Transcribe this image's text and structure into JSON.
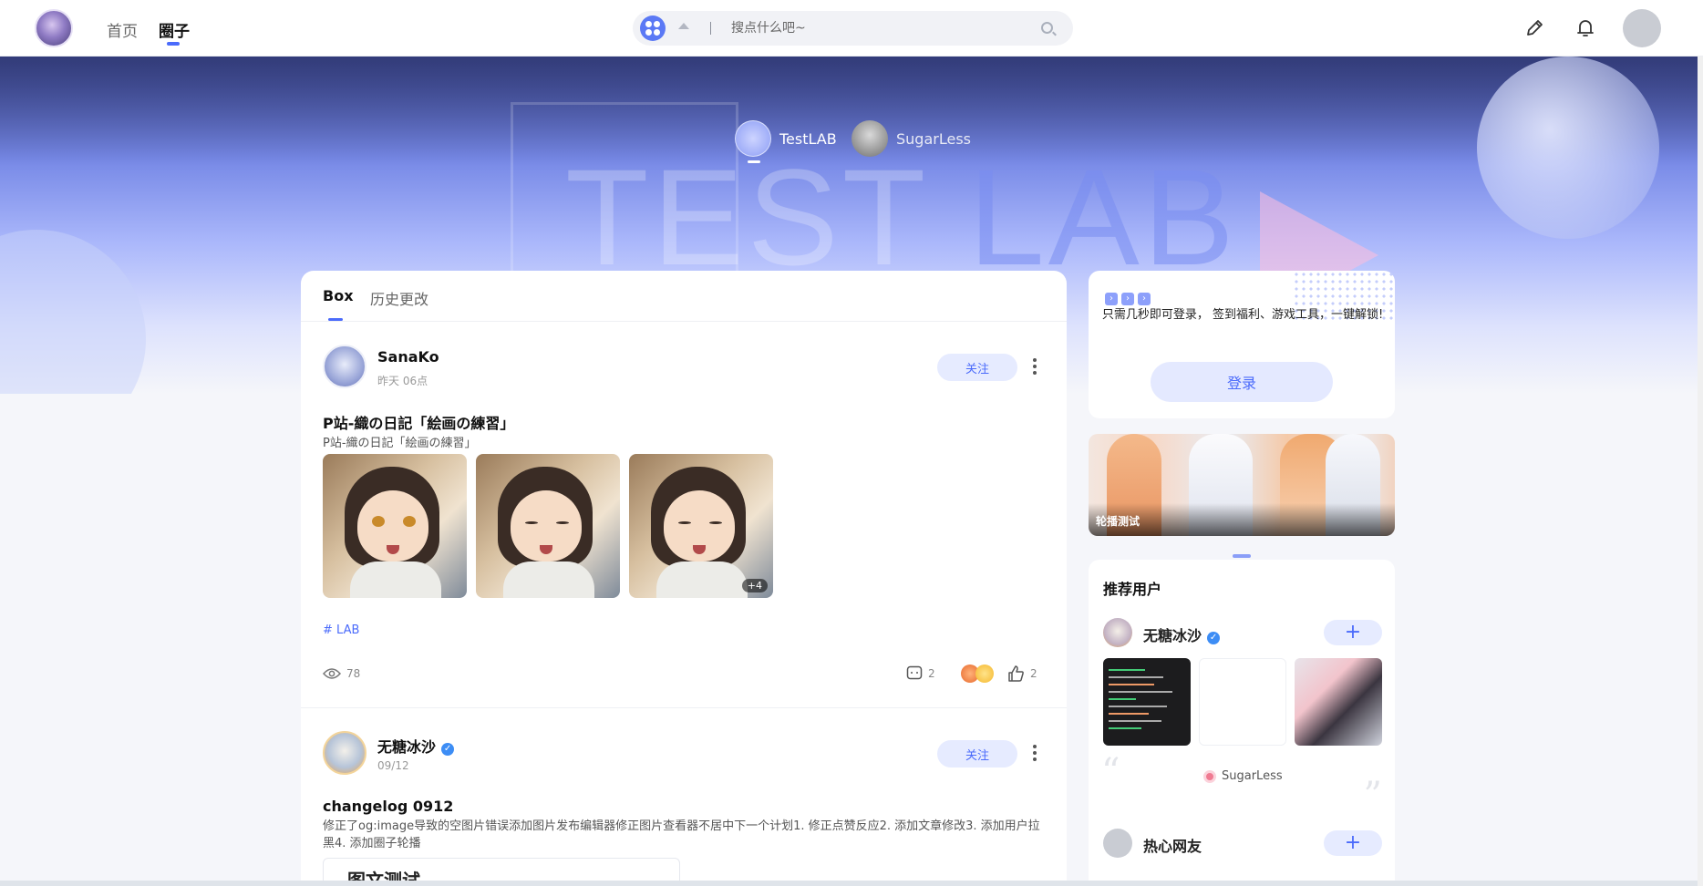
{
  "nav": {
    "home": "首页",
    "circle": "圈子",
    "search_placeholder": "搜点什么吧~"
  },
  "circles": [
    {
      "name": "TestLAB"
    },
    {
      "name": "SugarLess"
    }
  ],
  "hero": {
    "part1": "TEST ",
    "part2": "LAB"
  },
  "feed_tabs": {
    "box": "Box",
    "history": "历史更改"
  },
  "posts": [
    {
      "author": "SanaKo",
      "time": "昨天 06点",
      "follow": "关注",
      "title": "P站-織の日記「絵画の練習」",
      "excerpt": "P站-織の日記「絵画の練習」",
      "more_images": "+4",
      "tag": "LAB",
      "views": "78",
      "comments": "2",
      "likes": "2"
    },
    {
      "author": "无糖冰沙",
      "time": "09/12",
      "follow": "关注",
      "title": "changelog 0912",
      "excerpt": "修正了og:image导致的空图片错误添加图片发布编辑器修正图片查看器不居中下一个计划1. 修正点赞反应2. 添加文章修改3. 添加用户拉黑4. 添加圈子轮播",
      "embed_title": "图文测试"
    }
  ],
  "sidebar": {
    "login_msg": "只需几秒即可登录， 签到福利、游戏工具，一键解锁!",
    "login_btn": "登录",
    "carousel_caption": "轮播测试",
    "rec_title": "推荐用户",
    "rec_users": [
      {
        "name": "无糖冰沙",
        "circle": "SugarLess"
      },
      {
        "name": "热心网友"
      }
    ]
  },
  "colors": {
    "accent": "#4b6bfb"
  },
  "icons": [
    "grid-icon",
    "caret-up-icon",
    "search-icon",
    "pencil-icon",
    "bell-icon",
    "more-icon",
    "hash-icon",
    "eye-icon",
    "comment-icon",
    "thumb-up-icon",
    "verified-icon",
    "plus-icon",
    "quote-icon"
  ]
}
